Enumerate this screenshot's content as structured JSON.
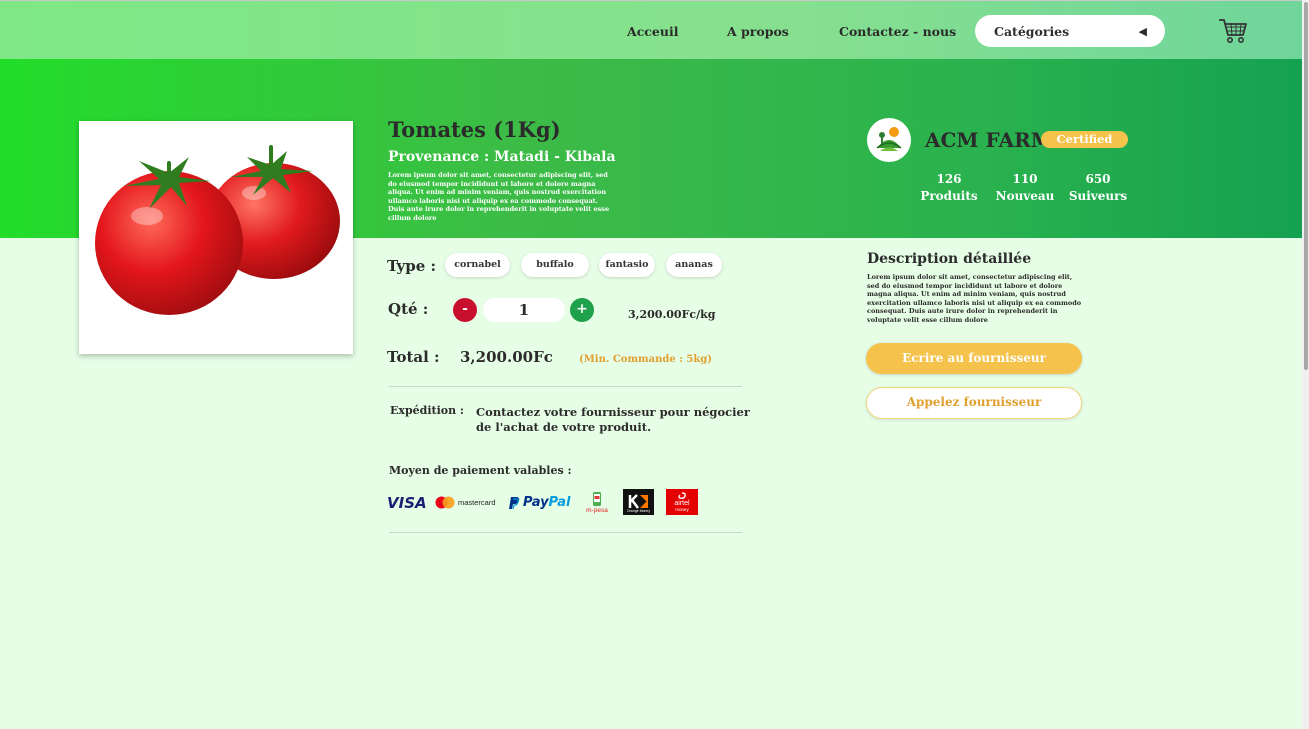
{
  "nav": {
    "links": [
      "Acceuil",
      "A propos",
      "Contactez - nous"
    ],
    "category_select": "Catégories",
    "cart_icon": "shopping-cart-icon"
  },
  "product": {
    "title": "Tomates (1Kg)",
    "origin": "Provenance : Matadi - Kibala",
    "short_description": "Lorem ipsum dolor sit amet, consectetur adipiscing elit, sed do eiusmod tempor incididunt ut labore et dolore magna aliqua. Ut enim ad minim veniam, quis nostrud exercitation ullamco laboris nisi ut aliquip ex ea commodo consequat. Duis aute irure dolor in reprehenderit in voluptate velit esse cillum dolore",
    "type_label": "Type :",
    "types": [
      "cornabel",
      "buffalo",
      "fantasio",
      "ananas"
    ],
    "qty_label": "Qté :",
    "qty_minus": "-",
    "qty_plus": "+",
    "qty_value": "1",
    "unit_price": "3,200.00Fc/kg",
    "total_label": "Total :",
    "total_value": "3,200.00Fc",
    "min_order": "(Min. Commande : 5kg)",
    "shipping_label": "Expédition :",
    "shipping_text": "Contactez votre fournisseur pour négocier de l'achat de votre produit.",
    "payment_label": "Moyen de paiement valables :",
    "payment_methods": {
      "visa": "VISA",
      "mastercard": "mastercard",
      "paypal_pay": "Pay",
      "paypal_pal": "Pal",
      "mpesa": "m-pesa",
      "orange": "Orange Money",
      "airtel": "airtel",
      "airtel_sub": "money"
    }
  },
  "supplier": {
    "name": "ACM FARM",
    "badge": "Certified",
    "stats": [
      {
        "value": "126",
        "label": "Produits"
      },
      {
        "value": "110",
        "label": "Nouveau"
      },
      {
        "value": "650",
        "label": "Suiveurs"
      }
    ],
    "description_title": "Description détaillée",
    "description_text": "Lorem ipsum dolor sit amet, consectetur adipiscing elit, sed do eiusmod tempor incididunt ut labore et dolore magna aliqua. Ut enim ad minim veniam, quis nostrud exercitation ullamco laboris nisi ut aliquip ex ea commodo consequat. Duis aute irure dolor in reprehenderit in voluptate velit esse cillum dolore",
    "write_button": "Ecrire au fournisseur",
    "call_button": "Appelez fournisseur"
  },
  "colors": {
    "accent_yellow": "#f5c24b",
    "hero_green": "#3dbb47",
    "minus_red": "#c8102e",
    "plus_green": "#1fa04a",
    "background": "#e6fde6"
  }
}
